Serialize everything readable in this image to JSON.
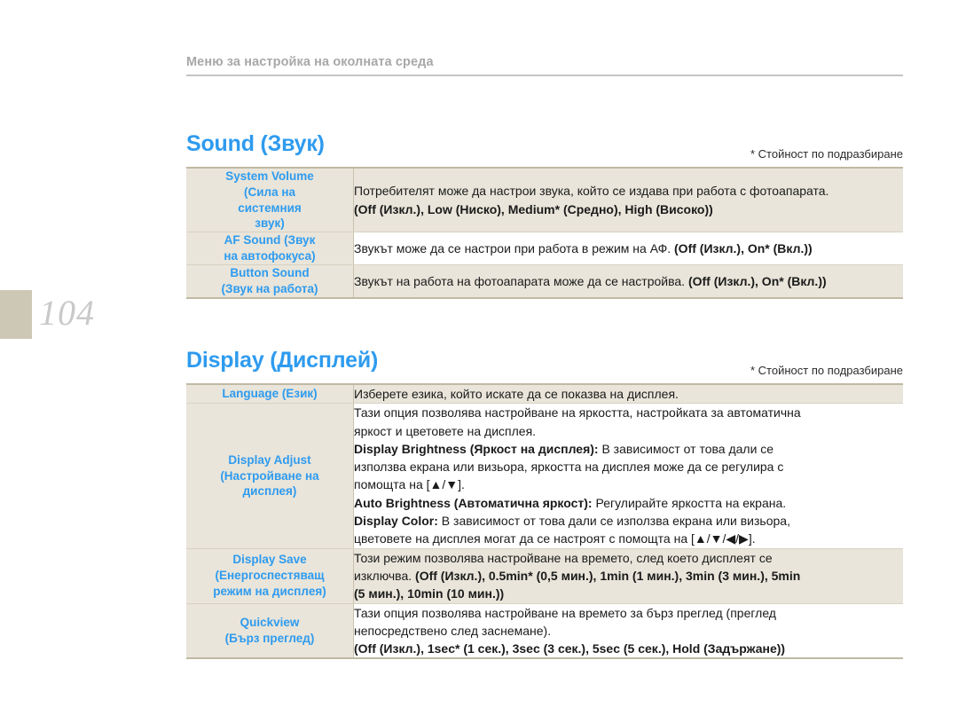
{
  "page": {
    "number": "104",
    "header_title": "Меню за настройка на околната среда"
  },
  "sections": [
    {
      "id": "sound",
      "title": "Sound (Звук)",
      "default_note": "* Стойност по подразбиране",
      "rows": [
        {
          "label_en": "System Volume",
          "label_bg": "(Сила на системния звук)",
          "lines": [
            "Потребителят може да настрои звука, който се издава при работа с фотоапарата.",
            "(Off (Изкл.), Low (Ниско), Medium* (Средно), High (Високо))"
          ]
        },
        {
          "label_en": "AF Sound (Звук",
          "label_bg": "на автофокуса)",
          "lines": [
            "Звукът може да се настрои при работа в режим на АФ. (Off (Изкл.), On* (Вкл.))"
          ]
        },
        {
          "label_en": "Button Sound",
          "label_bg": "(Звук на работа)",
          "lines": [
            "Звукът на работа на фотоапарата може да се настройва. (Off (Изкл.), On* (Вкл.))"
          ]
        }
      ]
    },
    {
      "id": "display",
      "title": "Display (Дисплей)",
      "default_note": "* Стойност по подразбиране",
      "rows": [
        {
          "label_en": "Language (Език)",
          "label_bg": "",
          "lines": [
            "Изберете езика, който искате да се показва на дисплея."
          ]
        },
        {
          "label_en": "Display Adjust",
          "label_bg": "(Настройване на дисплея)",
          "lines": [
            "Тази опция позволява настройване на яркостта, настройката за автоматична",
            "яркост и цветовете на дисплея.",
            "Display Brightness (Яркост на дисплея): В зависимост от това дали се",
            "използва екрана или визьора, яркостта на дисплея може да се регулира с",
            "помощта на [▲/▼].",
            "Auto Brightness (Автоматична яркост): Регулирайте яркостта на екрана.",
            "Display Color: В зависимост от това дали се използва екрана или визьора,",
            "цветовете на дисплея могат да се настроят с помощта на [▲/▼/◀/▶]."
          ]
        },
        {
          "label_en": "Display Save",
          "label_bg": "(Енергоспестяващ режим на дисплея)",
          "lines": [
            "Този режим позволява настройване на времето, след което дисплеят се",
            "изключва.  (Off (Изкл.), 0.5min* (0,5 мин.), 1min (1 мин.), 3min (3 мин.), 5min",
            "(5 мин.), 10min (10 мин.))"
          ]
        },
        {
          "label_en": "Quickview",
          "label_bg": "(Бърз преглед)",
          "lines": [
            "Тази опция позволява настройване на времето за бърз преглед (преглед",
            "непосредствено след заснемане).",
            "(Off (Изкл.), 1sec* (1 сек.), 3sec (3 сек.), 5sec (5 сек.), Hold (Задържане))"
          ]
        }
      ]
    }
  ],
  "table_text": {
    "sound": {
      "r0_l0": "Потребителят може да настрои звука, който се издава при работа с фотоапарата.",
      "r0_l1": "(Off (Изкл.), Low (Ниско), Medium* (Средно), High (Високо))",
      "r1_l0_a": "Звукът може да се настрои при работа в режим на АФ. ",
      "r1_l0_b": "(Off (Изкл.), On* (Вкл.))",
      "r2_l0_a": "Звукът на работа на фотоапарата може да се настройва. ",
      "r2_l0_b": "(Off (Изкл.), On* (Вкл.))"
    },
    "display": {
      "r0_l0": "Изберете езика, който искате да се показва на дисплея.",
      "r1_l0": "Тази опция позволява настройване на яркостта, настройката за автоматична",
      "r1_l1": "яркост и цветовете на дисплея.",
      "r1_l2_b": "Display Brightness (Яркост на дисплея):",
      "r1_l2_a": " В зависимост от това дали се",
      "r1_l3": "използва екрана или визьора, яркостта на дисплея може да се регулира с",
      "r1_l4": "помощта на [▲/▼].",
      "r1_l5_b": "Auto Brightness (Автоматична яркост):",
      "r1_l5_a": " Регулирайте яркостта на екрана.",
      "r1_l6_b": "Display Color:",
      "r1_l6_a": " В зависимост от това дали се използва екрана или визьора,",
      "r1_l7": "цветовете на дисплея могат да се настроят с помощта на [▲/▼/◀/▶].",
      "r2_l0": "Този режим позволява настройване на времето, след което дисплеят се",
      "r2_l1_a": "изключва.  ",
      "r2_l1_b": "(Off (Изкл.), 0.5min* (0,5 мин.), 1min (1 мин.), 3min (3 мин.), 5min",
      "r2_l2_b": "(5 мин.), 10min (10 мин.))",
      "r3_l0": "Тази опция позволява настройване на времето за бърз преглед (преглед",
      "r3_l1": "непосредствено след заснемане).",
      "r3_l2_b": "(Off (Изкл.), 1sec* (1 сек.), 3sec (3 сек.), 5sec (5 сек.), Hold (Задържане))"
    }
  },
  "labels": {
    "sound": {
      "r0_en": "System Volume",
      "r0_bg1": "(Сила на",
      "r0_bg2": "системния",
      "r0_bg3": "звук)",
      "r1_en": "AF Sound (Звук",
      "r1_bg": "на автофокуса)",
      "r2_en": "Button Sound",
      "r2_bg": "(Звук на работа)"
    },
    "display": {
      "r0_en": "Language (Език)",
      "r1_en": "Display Adjust",
      "r1_bg1": "(Настройване на",
      "r1_bg2": "дисплея)",
      "r2_en": "Display Save",
      "r2_bg1": "(Енергоспестяващ",
      "r2_bg2": "режим на дисплея)",
      "r3_en": "Quickview",
      "r3_bg": "(Бърз преглед)"
    }
  },
  "colors": {
    "accent_blue": "#2e9bef",
    "table_tint": "#e9e5da",
    "rule_tan": "#c0b9a4",
    "header_gray": "#a8a8a8",
    "page_marker": "#cdc7b5"
  }
}
